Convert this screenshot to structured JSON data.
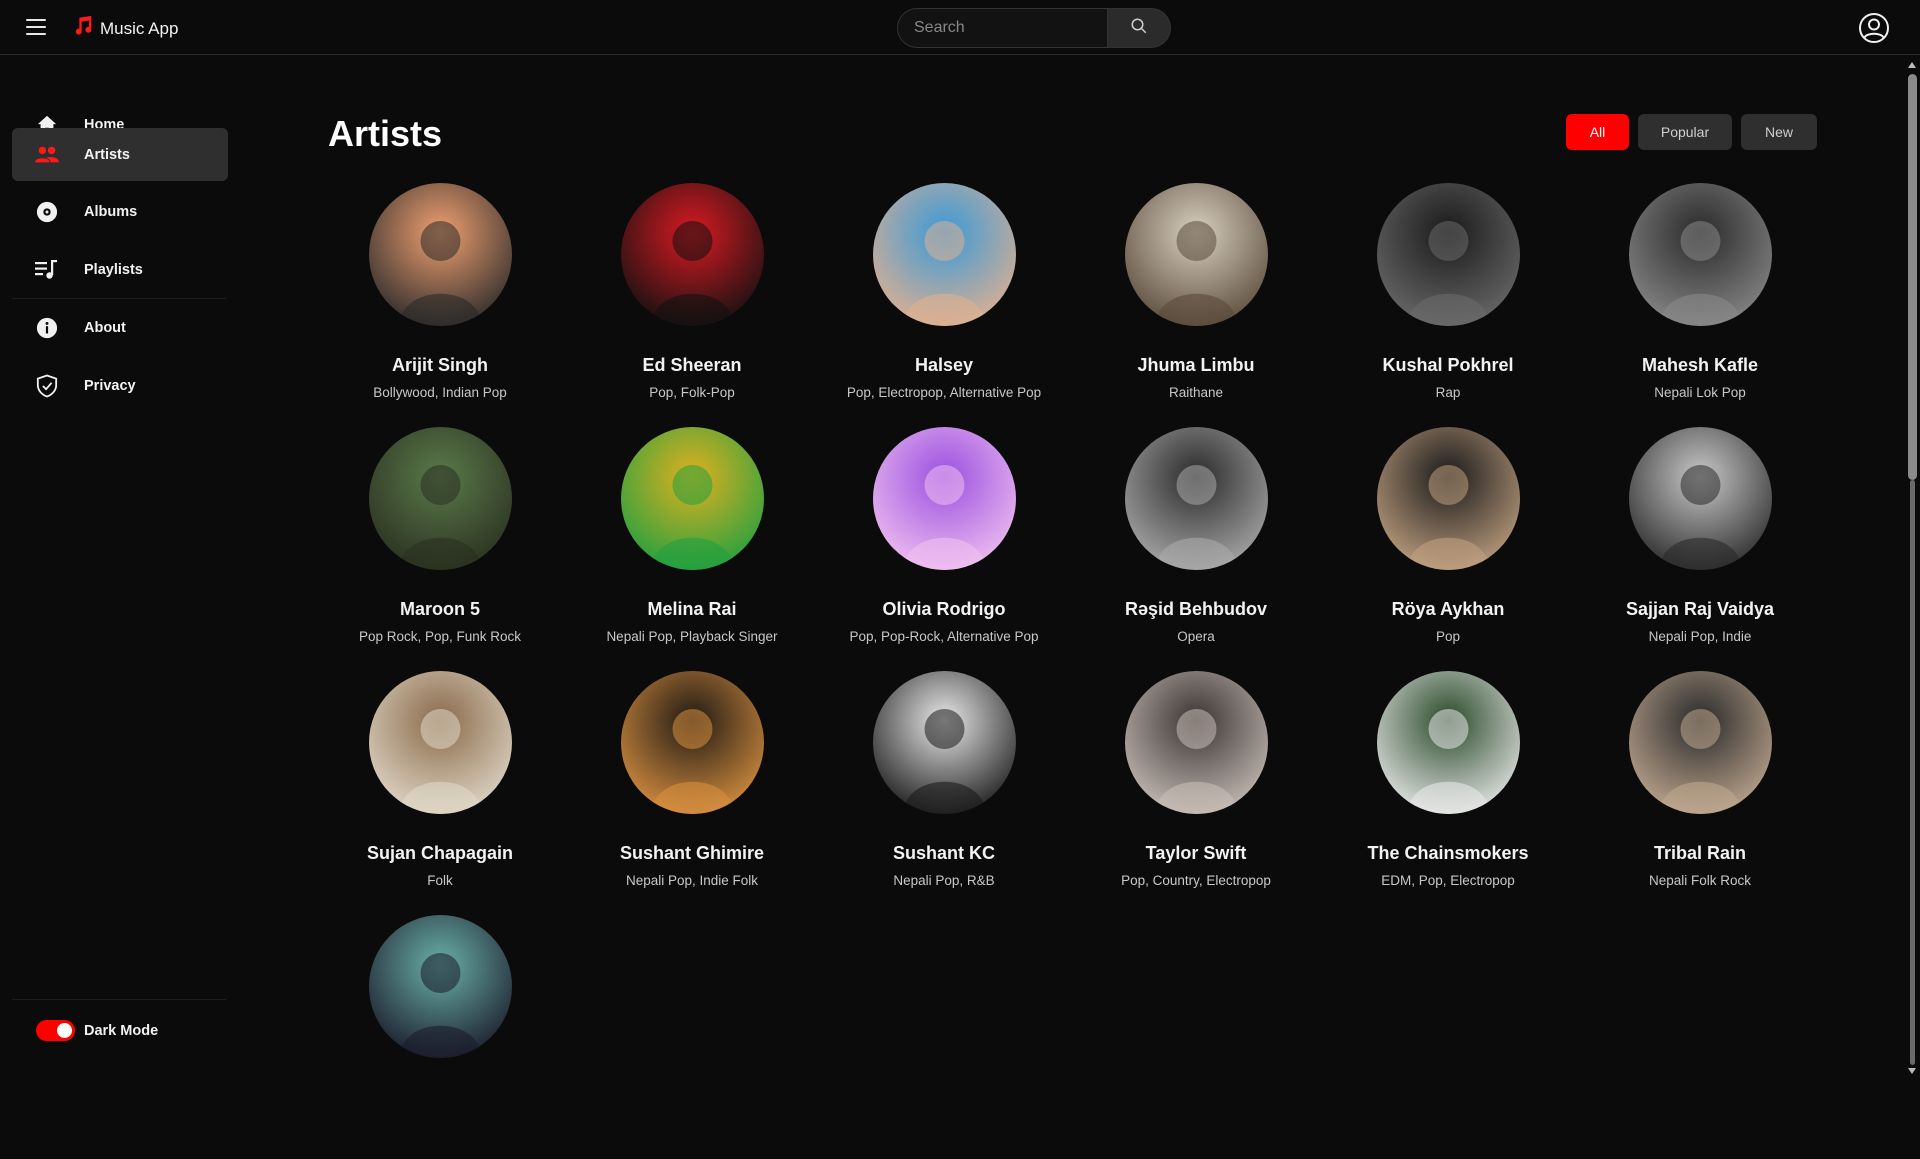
{
  "app": {
    "name": "Music App",
    "accent": "#ff0000"
  },
  "search": {
    "placeholder": "Search"
  },
  "sidebar": {
    "items": [
      {
        "label": "Home",
        "icon": "home-icon"
      },
      {
        "label": "Artists",
        "icon": "users-icon",
        "active": true
      },
      {
        "label": "Albums",
        "icon": "disc-icon"
      },
      {
        "label": "Playlists",
        "icon": "playlist-icon"
      },
      {
        "label": "About",
        "icon": "info-icon"
      },
      {
        "label": "Privacy",
        "icon": "shield-icon"
      }
    ],
    "dark_mode_label": "Dark Mode",
    "dark_mode_on": true
  },
  "main": {
    "title": "Artists",
    "filters": [
      {
        "label": "All",
        "active": true
      },
      {
        "label": "Popular"
      },
      {
        "label": "New"
      }
    ],
    "artists": [
      {
        "name": "Arijit Singh",
        "genre": "Bollywood, Indian Pop",
        "colors": [
          "#f0a070",
          "#2a2a2a"
        ]
      },
      {
        "name": "Ed Sheeran",
        "genre": "Pop, Folk-Pop",
        "colors": [
          "#d81a22",
          "#111111"
        ]
      },
      {
        "name": "Halsey",
        "genre": "Pop, Electropop, Alternative Pop",
        "colors": [
          "#3a9ad8",
          "#e0b090"
        ]
      },
      {
        "name": "Jhuma Limbu",
        "genre": "Raithane",
        "colors": [
          "#d8d0c0",
          "#5a4a3a"
        ]
      },
      {
        "name": "Kushal Pokhrel",
        "genre": "Rap",
        "colors": [
          "#1a1a1a",
          "#6a6a6a"
        ]
      },
      {
        "name": "Mahesh Kafle",
        "genre": "Nepali Lok Pop",
        "colors": [
          "#2a2a2a",
          "#888888"
        ]
      },
      {
        "name": "Maroon 5",
        "genre": "Pop Rock, Pop, Funk Rock",
        "colors": [
          "#5a7a4a",
          "#2a3020"
        ]
      },
      {
        "name": "Melina Rai",
        "genre": "Nepali Pop, Playback Singer",
        "colors": [
          "#e0b020",
          "#20a040"
        ]
      },
      {
        "name": "Olivia Rodrigo",
        "genre": "Pop, Pop-Rock, Alternative Pop",
        "colors": [
          "#9a50e0",
          "#f0c0f0"
        ]
      },
      {
        "name": "Rəşid Behbudov",
        "genre": "Opera",
        "colors": [
          "#2a2a2a",
          "#aaaaaa"
        ]
      },
      {
        "name": "Röya Aykhan",
        "genre": "Pop",
        "colors": [
          "#1a1a1a",
          "#c0a080"
        ]
      },
      {
        "name": "Sajjan Raj Vaidya",
        "genre": "Nepali Pop, Indie",
        "colors": [
          "#c8c8c8",
          "#2a2a2a"
        ]
      },
      {
        "name": "Sujan Chapagain",
        "genre": "Folk",
        "colors": [
          "#8a6a4a",
          "#e0d8c8"
        ]
      },
      {
        "name": "Sushant Ghimire",
        "genre": "Nepali Pop, Indie Folk",
        "colors": [
          "#201a14",
          "#d89040"
        ]
      },
      {
        "name": "Sushant KC",
        "genre": "Nepali Pop, R&B",
        "colors": [
          "#e8e8e8",
          "#1a1a1a"
        ]
      },
      {
        "name": "Taylor Swift",
        "genre": "Pop, Country, Electropop",
        "colors": [
          "#3a3432",
          "#c8beb8"
        ]
      },
      {
        "name": "The Chainsmokers",
        "genre": "EDM, Pop, Electropop",
        "colors": [
          "#2a4a2a",
          "#e8e8e8"
        ]
      },
      {
        "name": "Tribal Rain",
        "genre": "Nepali Folk Rock",
        "colors": [
          "#2a2a2a",
          "#c0a890"
        ]
      },
      {
        "name": "",
        "genre": "",
        "colors": [
          "#6ab0a8",
          "#1a1a2a"
        ]
      }
    ]
  }
}
